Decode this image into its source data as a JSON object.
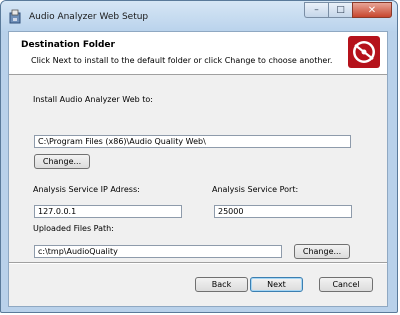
{
  "window": {
    "title": "Audio Analyzer Web Setup",
    "caption": {
      "minimize": "–",
      "maximize": "□",
      "close": "✕"
    }
  },
  "banner": {
    "title": "Destination Folder",
    "description": "Click Next to install to the default folder or click Change to choose another."
  },
  "install": {
    "label": "Install Audio Analyzer Web to:",
    "path": "C:\\Program Files (x86)\\Audio Quality Web\\",
    "change_label": "Change..."
  },
  "service": {
    "ip_label": "Analysis Service IP Adress:",
    "ip_value": "127.0.0.1",
    "port_label": "Analysis Service Port:",
    "port_value": "25000"
  },
  "uploads": {
    "label": "Uploaded Files Path:",
    "path": "c:\\tmp\\AudioQuality",
    "change_label": "Change..."
  },
  "footer": {
    "back_label": "Back",
    "next_label": "Next",
    "cancel_label": "Cancel"
  },
  "colors": {
    "logo_red": "#b5121b",
    "close_red": "#c7462e",
    "default_button_border": "#3c7fb1"
  },
  "icons": {
    "app": "installer-icon",
    "banner": "audio-disc-icon"
  }
}
